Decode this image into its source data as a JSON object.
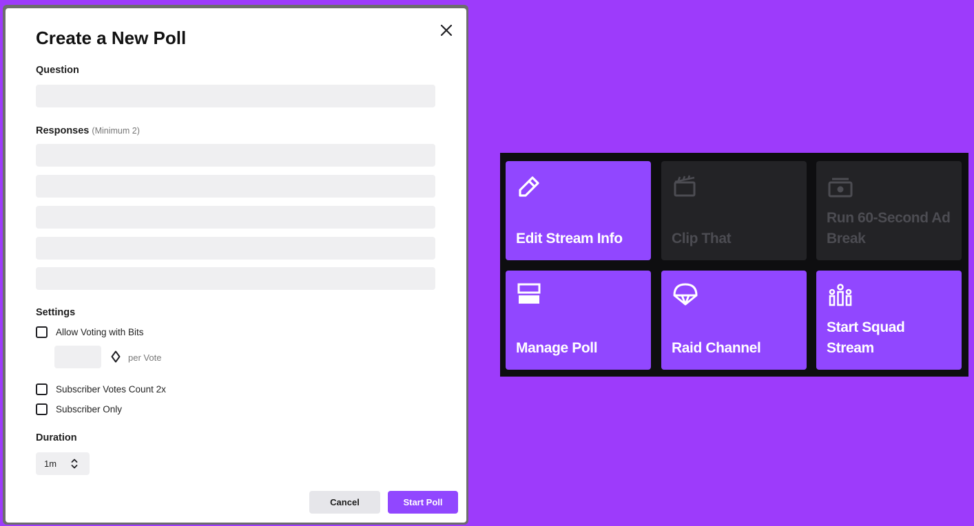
{
  "dialog": {
    "title": "Create a New Poll",
    "question_label": "Question",
    "question_value": "",
    "responses_label": "Responses",
    "responses_hint": "(Minimum 2)",
    "responses": [
      "",
      "",
      "",
      "",
      ""
    ],
    "settings_label": "Settings",
    "allow_bits_label": "Allow Voting with Bits",
    "bits_amount": "",
    "per_vote_label": "per Vote",
    "sub_votes_label": "Subscriber Votes Count 2x",
    "sub_only_label": "Subscriber Only",
    "duration_label": "Duration",
    "duration_value": "1m",
    "cancel_label": "Cancel",
    "start_label": "Start Poll"
  },
  "quick_actions": [
    {
      "label": "Edit Stream Info",
      "icon": "pencil-icon",
      "enabled": true
    },
    {
      "label": "Clip That",
      "icon": "clapperboard-icon",
      "enabled": false
    },
    {
      "label": "Run 60-Second Ad Break",
      "icon": "ad-money-icon",
      "enabled": false
    },
    {
      "label": "Manage Poll",
      "icon": "poll-icon",
      "enabled": true
    },
    {
      "label": "Raid Channel",
      "icon": "parachute-icon",
      "enabled": true
    },
    {
      "label": "Start Squad Stream",
      "icon": "squad-icon",
      "enabled": true
    }
  ],
  "colors": {
    "background": "#9d3bfb",
    "accent": "#9147ff",
    "panel": "#0e0e10",
    "tile_disabled": "#232326",
    "field": "#efeff1"
  }
}
